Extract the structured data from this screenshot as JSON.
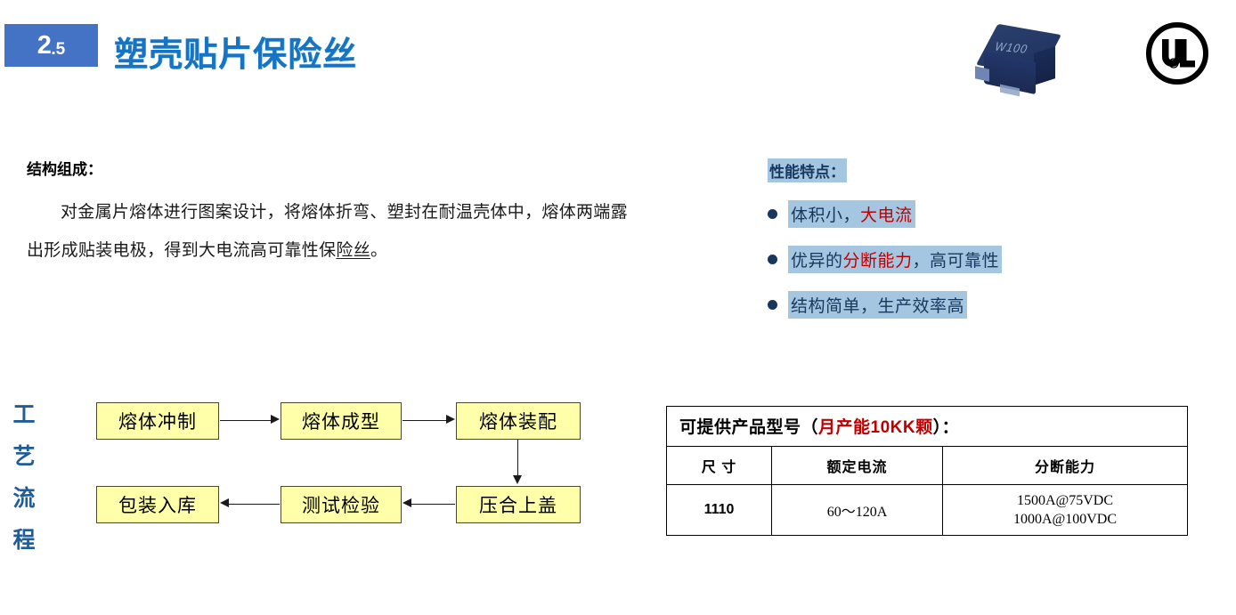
{
  "header": {
    "section_major": "2",
    "section_minor": ".5",
    "title": "塑壳贴片保险丝",
    "badge_color": "#4472c4",
    "title_color": "#1575c4",
    "product_photo_marking": "W100",
    "ul_letters": "UL",
    "ul_registered": "®"
  },
  "structure": {
    "heading": "结构组成：",
    "body_part1": "对金属片熔体进行图案设计，将熔体折弯、塑封在耐温壳体中，熔体两端露出形成贴装电极，得到大电流高可靠性保",
    "body_part2": "险丝",
    "body_part3": "。"
  },
  "features": {
    "heading": "性能特点：",
    "highlight_color": "#a5c6e0",
    "text_color": "#17375e",
    "accent_color": "#c00000",
    "items": [
      {
        "plain_a": "体积小，",
        "accent": "大电流",
        "plain_b": ""
      },
      {
        "plain_a": "优异的",
        "accent": "分断能力",
        "plain_b": "，高可靠性"
      },
      {
        "plain_a": "结构简单，生产效率高",
        "accent": "",
        "plain_b": ""
      }
    ]
  },
  "process_flow": {
    "vertical_label": [
      "工",
      "艺",
      "流",
      "程"
    ],
    "label_color": "#1f5c99",
    "box_fill": "#ffffaa",
    "steps": [
      "熔体冲制",
      "熔体成型",
      "熔体装配",
      "压合上盖",
      "测试检验",
      "包装入库"
    ]
  },
  "spec_table": {
    "title_black_a": "可提供产品型号（",
    "title_red": "月产能10KK颗",
    "title_black_b": "）：",
    "columns": [
      "尺 寸",
      "额定电流",
      "分断能力"
    ],
    "rows": [
      {
        "size": "1110",
        "rated_current": "60～120A",
        "breaking_capacity_line1": "1500A@75VDC",
        "breaking_capacity_line2": "1000A@100VDC"
      }
    ]
  }
}
